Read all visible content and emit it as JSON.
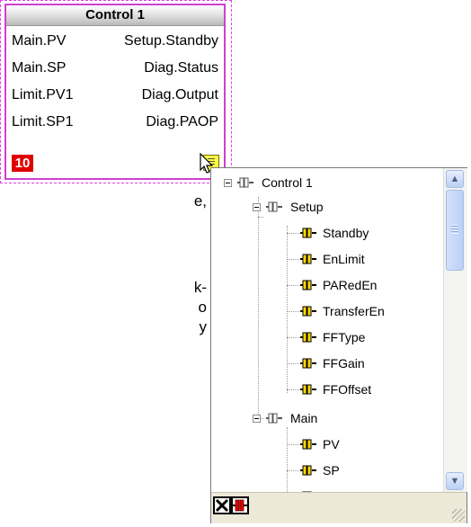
{
  "block": {
    "title": "Control 1",
    "rows": [
      {
        "left": "Main.PV",
        "right": "Setup.Standby"
      },
      {
        "left": "Main.SP",
        "right": "Diag.Status"
      },
      {
        "left": "Limit.PV1",
        "right": "Diag.Output"
      },
      {
        "left": "Limit.SP1",
        "right": "Diag.PAOP"
      }
    ],
    "fault_count": "10",
    "expand_icon": "parameter-list-icon"
  },
  "background_text": [
    "e,",
    "k-",
    "o",
    "y"
  ],
  "tree": {
    "root": "Control 1",
    "folders": [
      {
        "name": "Setup",
        "items": [
          "Standby",
          "EnLimit",
          "PARedEn",
          "TransferEn",
          "FFType",
          "FFGain",
          "FFOffset"
        ]
      },
      {
        "name": "Main",
        "items": [
          "PV",
          "SP"
        ]
      }
    ],
    "toolbar": {
      "close_icon": "close-icon",
      "connect_icon": "connect-icon"
    }
  },
  "colors": {
    "selection_border": "#d040d0",
    "fault_badge": "#e00000",
    "parameter_icon": "#ffd800"
  }
}
